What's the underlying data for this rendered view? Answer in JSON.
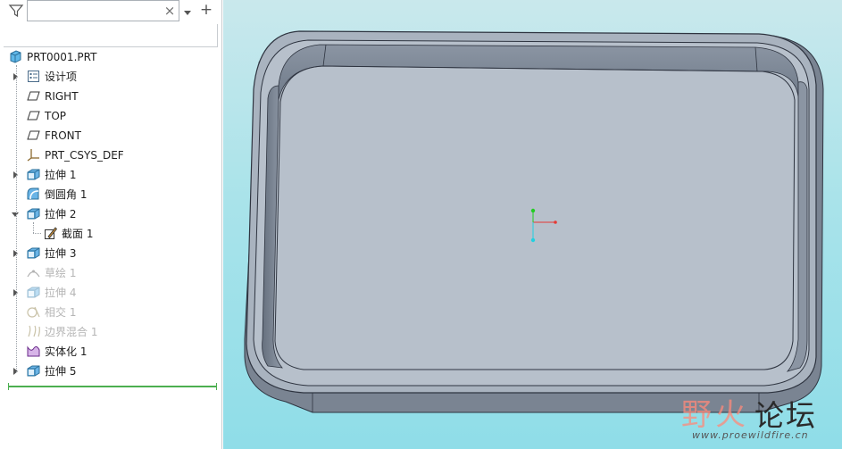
{
  "model_tree": {
    "search": {
      "value": "",
      "clear_glyph": "×"
    },
    "add_glyph": "+",
    "icons": {
      "filter": "filter-icon",
      "dropdown": "chevron-down-icon",
      "add": "plus-icon"
    },
    "items": [
      {
        "label": "PRT0001.PRT",
        "icon": "part-icon",
        "expander": "none",
        "suppressed": false
      },
      {
        "label": "设计项",
        "icon": "design-items-icon",
        "expander": "collapsed",
        "suppressed": false
      },
      {
        "label": "RIGHT",
        "icon": "datum-plane-icon",
        "expander": "none",
        "suppressed": false
      },
      {
        "label": "TOP",
        "icon": "datum-plane-icon",
        "expander": "none",
        "suppressed": false
      },
      {
        "label": "FRONT",
        "icon": "datum-plane-icon",
        "expander": "none",
        "suppressed": false
      },
      {
        "label": "PRT_CSYS_DEF",
        "icon": "coordinate-system-icon",
        "expander": "none",
        "suppressed": false
      },
      {
        "label": "拉伸 1",
        "icon": "extrude-icon",
        "expander": "collapsed",
        "suppressed": false
      },
      {
        "label": "倒圆角 1",
        "icon": "round-icon",
        "expander": "none",
        "suppressed": false
      },
      {
        "label": "拉伸 2",
        "icon": "extrude-icon",
        "expander": "expanded",
        "suppressed": false
      },
      {
        "label": "截面 1",
        "icon": "sketch-section-icon",
        "expander": "none",
        "suppressed": false
      },
      {
        "label": "拉伸 3",
        "icon": "extrude-icon",
        "expander": "collapsed",
        "suppressed": false
      },
      {
        "label": "草绘 1",
        "icon": "sketch-icon",
        "expander": "none",
        "suppressed": true
      },
      {
        "label": "拉伸 4",
        "icon": "extrude-icon",
        "expander": "collapsed",
        "suppressed": true
      },
      {
        "label": "相交 1",
        "icon": "intersect-icon",
        "expander": "none",
        "suppressed": true
      },
      {
        "label": "边界混合 1",
        "icon": "boundary-blend-icon",
        "expander": "none",
        "suppressed": true
      },
      {
        "label": "实体化 1",
        "icon": "solidify-icon",
        "expander": "none",
        "suppressed": false
      },
      {
        "label": "拉伸 5",
        "icon": "extrude-icon",
        "expander": "collapsed",
        "suppressed": false
      }
    ]
  },
  "viewport": {
    "background_top": "#c9e8ec",
    "background_bottom": "#8fdde8",
    "model_color": "#7c8696",
    "triad_colors": {
      "x": "#e53935",
      "y": "#22cc22",
      "z": "#22d0e0"
    },
    "watermark": {
      "cn_wild": "野火",
      "cn_forum": "论坛",
      "url": "www.proewildfire.cn"
    }
  }
}
